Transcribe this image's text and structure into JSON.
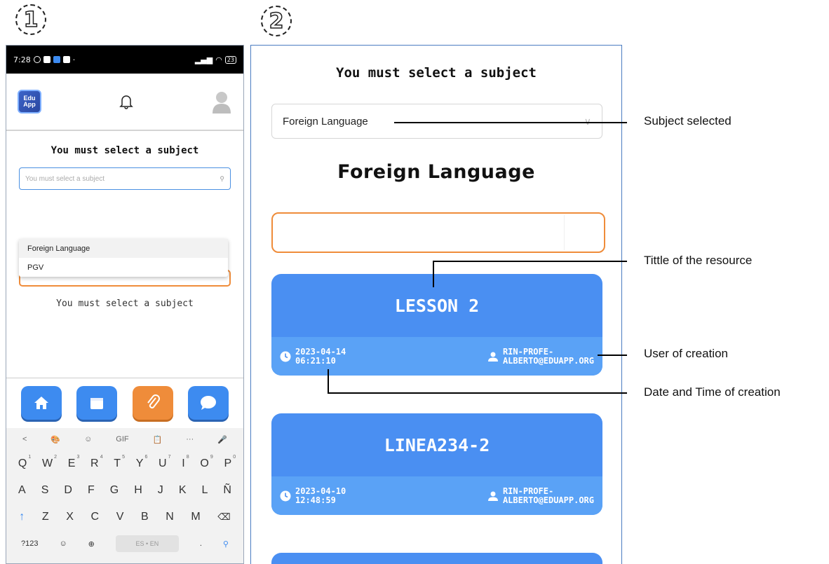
{
  "steps": [
    "1",
    "2"
  ],
  "phone": {
    "status": {
      "time": "7:28",
      "battery": "23"
    },
    "appbar": {
      "logo_line1": "Edu",
      "logo_line2": "App"
    },
    "heading": "You must select a subject",
    "select_placeholder": "You must select a subject",
    "options": [
      "Foreign Language",
      "PGV"
    ],
    "message": "You must select a subject",
    "keyboard": {
      "top_row": [
        "<",
        "🎨",
        "☺",
        "GIF",
        "📋",
        "···",
        "🎤"
      ],
      "row1": [
        [
          "Q",
          "1"
        ],
        [
          "W",
          "2"
        ],
        [
          "E",
          "3"
        ],
        [
          "R",
          "4"
        ],
        [
          "T",
          "5"
        ],
        [
          "Y",
          "6"
        ],
        [
          "U",
          "7"
        ],
        [
          "I",
          "8"
        ],
        [
          "O",
          "9"
        ],
        [
          "P",
          "0"
        ]
      ],
      "row2": [
        "A",
        "S",
        "D",
        "F",
        "G",
        "H",
        "J",
        "K",
        "L",
        "Ñ"
      ],
      "row3": [
        "↑",
        "Z",
        "X",
        "C",
        "V",
        "B",
        "N",
        "M",
        "⌫"
      ],
      "row4_left": "?123",
      "row4_space": "ES • EN",
      "row4_period": "."
    }
  },
  "panel": {
    "heading": "You must select a subject",
    "selected_subject": "Foreign Language",
    "subject_title": "Foreign Language",
    "cards": [
      {
        "title": "LESSON 2",
        "date": "2023-04-14",
        "time": "06:21:10",
        "user_line1": "RIN-PROFE-",
        "user_line2": "ALBERTO@EDUAPP.ORG"
      },
      {
        "title": "LINEA234-2",
        "date": "2023-04-10",
        "time": "12:48:59",
        "user_line1": "RIN-PROFE-",
        "user_line2": "ALBERTO@EDUAPP.ORG"
      }
    ]
  },
  "annotations": {
    "subject_selected": "Subject selected",
    "title_resource": "Tittle of the resource",
    "user_creation": "User of creation",
    "date_time_creation": "Date and Time of creation"
  },
  "colors": {
    "card_blue": "#4a8ff2",
    "accent_orange": "#ef8c3a",
    "select_blue": "#4a90e2"
  }
}
